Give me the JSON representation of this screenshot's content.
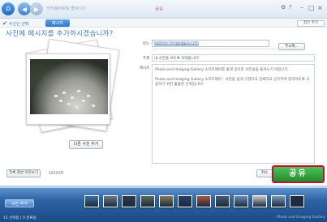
{
  "titlebar": {
    "breadcrumb": "타이틀바위치 즐겨기기",
    "window_title": "공유",
    "help_icon": "gear-help",
    "help_mark": "?",
    "minimize_glyph": "–",
    "maximize_glyph": "□",
    "close_glyph": "×"
  },
  "steps": {
    "step1_label": "수신인 선택",
    "step2_label": "메시지",
    "back_label": "접은 추가"
  },
  "heading": "사진에 메시지를 추가하시겠습니까?",
  "form": {
    "to_label": "받는",
    "to_value": "kpoteer.henge@jpa.com",
    "address_button": "주소록...",
    "subject_label": "주제",
    "subject_value": "내 사진을 보도록 초대합니다!",
    "message_label": "메시지",
    "message_paragraphs": [
      "Photo and Imaging Gallery 소프트웨어를 통해 공유한 사진들을 즐겨시기 바랍니다.",
      "Photo and Imaging Gallery 소프트웨어 - 사진을 쉽게 구경하고 인쇄하고 공유하며 정리하도록 사용하기 위한 훌륭한 선택입니다!"
    ]
  },
  "add_other_photo_button": "다른 사진 추가",
  "full_view_button": "전체 화면 미리보기",
  "count_text": "15이미지",
  "cancel_button": "취소",
  "share_button": "공유",
  "tray": {
    "add_photo_button": "사진 추가",
    "selected_count": "15 선택됨 | 0 분류됨",
    "brand": "Photo and Imaging Gallery",
    "thumbnail_colors": [
      "#3f6f9c",
      "#6c7a84",
      "#2f3b4a",
      "#5a6e55",
      "#8a7a5a",
      "#2a3f66",
      "#b0553c",
      "#4a5a70",
      "#6a8fb2",
      "#c7c9cc",
      "#7e9ab8",
      "#1e2e4a"
    ]
  },
  "colors": {
    "accent_blue": "#3e7cc0",
    "share_green": "#2a9a36",
    "share_border": "#c8102e",
    "title_pink": "#c0548c"
  }
}
